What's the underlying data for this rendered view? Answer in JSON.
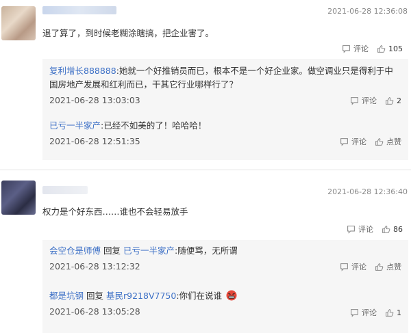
{
  "comments": [
    {
      "time": "2021-06-28 12:36:08",
      "content": "退了算了，到时候老糊涂瞎搞，把企业害了。",
      "comment_label": "评论",
      "like_count": "105",
      "replies": [
        {
          "user": "复利增长888888",
          "text": ":她就一个好推销员而已，根本不是一个好企业家。做空调业只是得利于中国房地产发展和红利而已，干其它行业哪样行了？",
          "time": "2021-06-28 13:03:03",
          "comment_label": "评论",
          "like_count": "2"
        },
        {
          "user": "已亏一半家产",
          "text": ":已经不如美的了！哈哈哈！",
          "time": "2021-06-28 12:51:35",
          "comment_label": "评论",
          "like_label": "点赞"
        }
      ]
    },
    {
      "time": "2021-06-28 12:36:40",
      "content": "权力是个好东西……谁也不会轻易放手",
      "comment_label": "评论",
      "like_count": "86",
      "replies": [
        {
          "user": "会空仓是师傅",
          "reply_word": "回复",
          "target": "已亏一半家产",
          "text": ":随便骂，无所谓",
          "time": "2021-06-28 13:12:32",
          "comment_label": "评论",
          "like_label": "点赞"
        },
        {
          "user": "都是坑钢",
          "reply_word": "回复",
          "target": "基民r9218V7750",
          "text": ":你们在说谁",
          "time": "2021-06-28 13:05:28",
          "comment_label": "评论",
          "like_count": "1"
        }
      ]
    }
  ],
  "colors": {
    "username": "#3d70c6",
    "reply_bg": "#f6f6f6",
    "time": "#888888"
  },
  "icons": {
    "comment": "comment-bubble-icon",
    "like": "thumbs-up-icon",
    "emoji": "angry-face-emoji"
  }
}
